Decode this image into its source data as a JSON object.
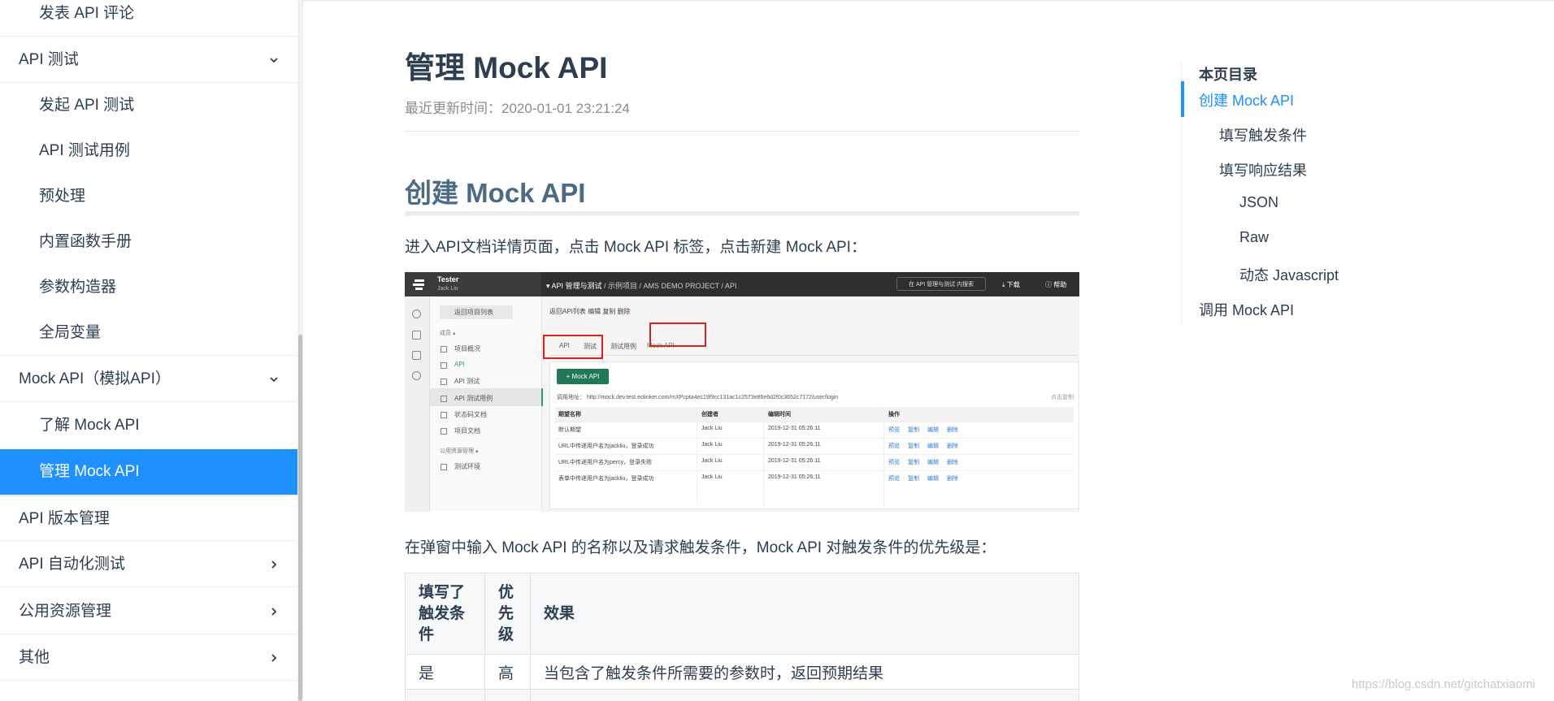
{
  "sidebar": {
    "items": [
      {
        "label": "发表 API 评论"
      },
      {
        "label": "API 测试"
      },
      {
        "label": "发起 API 测试"
      },
      {
        "label": "API 测试用例"
      },
      {
        "label": "预处理"
      },
      {
        "label": "内置函数手册"
      },
      {
        "label": "参数构造器"
      },
      {
        "label": "全局变量"
      },
      {
        "label": "Mock API（模拟API）"
      },
      {
        "label": "了解 Mock API"
      },
      {
        "label": "管理 Mock API"
      },
      {
        "label": "API 版本管理"
      },
      {
        "label": "API 自动化测试"
      },
      {
        "label": "公用资源管理"
      },
      {
        "label": "其他"
      }
    ]
  },
  "main": {
    "title": "管理 Mock API",
    "updated": "最近更新时间：2020-01-01 23:21:24",
    "h2": "创建 Mock API",
    "para1": "进入API文档详情页面，点击 Mock API 标签，点击新建 Mock API：",
    "para2": "在弹窗中输入 Mock API 的名称以及请求触发条件，Mock API 对触发条件的优先级是：",
    "table": {
      "headers": [
        "填写了\n触发条\n件",
        "优\n先\n级",
        "效果"
      ],
      "rows": [
        [
          "是",
          "高",
          "当包含了触发条件所需要的参数时，返回预期结果"
        ]
      ]
    }
  },
  "screenshot": {
    "user": "Tester",
    "user_sub": "Jack Liu",
    "crumb_bold": "API 管理与测试",
    "crumb_rest": " / 示例项目 / AMS DEMO PROJECT / API",
    "search": "在 API 管理与测试 内搜索",
    "download": "下载",
    "help": "帮助",
    "back": "返回项目列表",
    "nav_section1": "成员 ▴",
    "nav": [
      "项目概况",
      "API",
      "API 测试",
      "API 测试用例",
      "状态码文档",
      "项目文档"
    ],
    "nav_section2": "公用资源管理 ▴",
    "nav_env": "测试环境",
    "toolbar": "返回API列表     编辑     复制     删除",
    "tabs": [
      "API",
      "测试",
      "测试用例",
      "Mock API"
    ],
    "btn": "+  Mock API",
    "url_label": "调用地址：  http://mock.dev.test.eolinker.com/mXPcpta4ec19f9cc131ac1c2573e86e6d2f0c3652c7172/user/login",
    "url_right": "点击复制",
    "columns": [
      "期望名称",
      "创建者",
      "编辑时间",
      "操作"
    ],
    "rows": [
      [
        "默认期望",
        "Jack Liu",
        "2019-12-31 05:26:11"
      ],
      [
        "URL中传递用户名为jackliu，登录成功",
        "Jack Liu",
        "2019-12-31 05:26:11"
      ],
      [
        "URL中传递用户名为percy，登录失败",
        "Jack Liu",
        "2019-12-31 05:26:11"
      ],
      [
        "表单中传递用户名为jackliu，登录成功",
        "Jack Liu",
        "2019-12-31 05:26:11"
      ]
    ],
    "ops": [
      "预览",
      "复制",
      "编辑",
      "删除"
    ]
  },
  "toc": {
    "heading": "本页目录",
    "items": [
      {
        "label": "创建 Mock API"
      },
      {
        "label": "填写触发条件"
      },
      {
        "label": "填写响应结果"
      },
      {
        "label": "JSON"
      },
      {
        "label": "Raw"
      },
      {
        "label": "动态 Javascript"
      },
      {
        "label": "调用 Mock API"
      }
    ]
  },
  "watermark": "https://blog.csdn.net/gitchatxiaomi",
  "colors": {
    "accent": "#1e90ff",
    "heading": "#4a6a85",
    "mock_green": "#1f7a55",
    "highlight_red": "#e02020"
  }
}
